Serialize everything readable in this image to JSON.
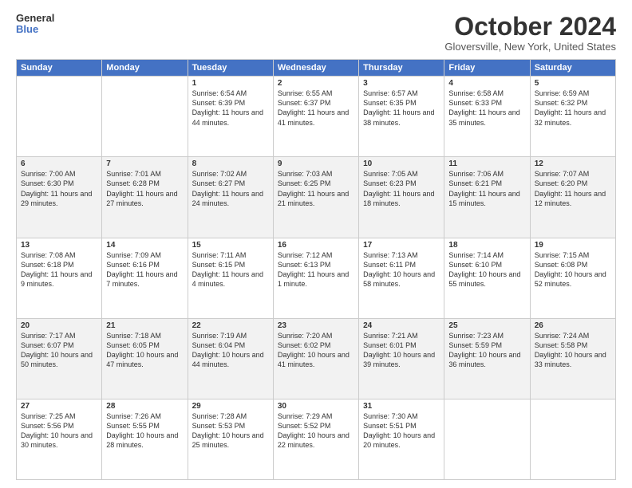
{
  "header": {
    "logo_line1": "General",
    "logo_line2": "Blue",
    "month": "October 2024",
    "location": "Gloversville, New York, United States"
  },
  "weekdays": [
    "Sunday",
    "Monday",
    "Tuesday",
    "Wednesday",
    "Thursday",
    "Friday",
    "Saturday"
  ],
  "weeks": [
    [
      {
        "day": "",
        "sunrise": "",
        "sunset": "",
        "daylight": ""
      },
      {
        "day": "",
        "sunrise": "",
        "sunset": "",
        "daylight": ""
      },
      {
        "day": "1",
        "sunrise": "Sunrise: 6:54 AM",
        "sunset": "Sunset: 6:39 PM",
        "daylight": "Daylight: 11 hours and 44 minutes."
      },
      {
        "day": "2",
        "sunrise": "Sunrise: 6:55 AM",
        "sunset": "Sunset: 6:37 PM",
        "daylight": "Daylight: 11 hours and 41 minutes."
      },
      {
        "day": "3",
        "sunrise": "Sunrise: 6:57 AM",
        "sunset": "Sunset: 6:35 PM",
        "daylight": "Daylight: 11 hours and 38 minutes."
      },
      {
        "day": "4",
        "sunrise": "Sunrise: 6:58 AM",
        "sunset": "Sunset: 6:33 PM",
        "daylight": "Daylight: 11 hours and 35 minutes."
      },
      {
        "day": "5",
        "sunrise": "Sunrise: 6:59 AM",
        "sunset": "Sunset: 6:32 PM",
        "daylight": "Daylight: 11 hours and 32 minutes."
      }
    ],
    [
      {
        "day": "6",
        "sunrise": "Sunrise: 7:00 AM",
        "sunset": "Sunset: 6:30 PM",
        "daylight": "Daylight: 11 hours and 29 minutes."
      },
      {
        "day": "7",
        "sunrise": "Sunrise: 7:01 AM",
        "sunset": "Sunset: 6:28 PM",
        "daylight": "Daylight: 11 hours and 27 minutes."
      },
      {
        "day": "8",
        "sunrise": "Sunrise: 7:02 AM",
        "sunset": "Sunset: 6:27 PM",
        "daylight": "Daylight: 11 hours and 24 minutes."
      },
      {
        "day": "9",
        "sunrise": "Sunrise: 7:03 AM",
        "sunset": "Sunset: 6:25 PM",
        "daylight": "Daylight: 11 hours and 21 minutes."
      },
      {
        "day": "10",
        "sunrise": "Sunrise: 7:05 AM",
        "sunset": "Sunset: 6:23 PM",
        "daylight": "Daylight: 11 hours and 18 minutes."
      },
      {
        "day": "11",
        "sunrise": "Sunrise: 7:06 AM",
        "sunset": "Sunset: 6:21 PM",
        "daylight": "Daylight: 11 hours and 15 minutes."
      },
      {
        "day": "12",
        "sunrise": "Sunrise: 7:07 AM",
        "sunset": "Sunset: 6:20 PM",
        "daylight": "Daylight: 11 hours and 12 minutes."
      }
    ],
    [
      {
        "day": "13",
        "sunrise": "Sunrise: 7:08 AM",
        "sunset": "Sunset: 6:18 PM",
        "daylight": "Daylight: 11 hours and 9 minutes."
      },
      {
        "day": "14",
        "sunrise": "Sunrise: 7:09 AM",
        "sunset": "Sunset: 6:16 PM",
        "daylight": "Daylight: 11 hours and 7 minutes."
      },
      {
        "day": "15",
        "sunrise": "Sunrise: 7:11 AM",
        "sunset": "Sunset: 6:15 PM",
        "daylight": "Daylight: 11 hours and 4 minutes."
      },
      {
        "day": "16",
        "sunrise": "Sunrise: 7:12 AM",
        "sunset": "Sunset: 6:13 PM",
        "daylight": "Daylight: 11 hours and 1 minute."
      },
      {
        "day": "17",
        "sunrise": "Sunrise: 7:13 AM",
        "sunset": "Sunset: 6:11 PM",
        "daylight": "Daylight: 10 hours and 58 minutes."
      },
      {
        "day": "18",
        "sunrise": "Sunrise: 7:14 AM",
        "sunset": "Sunset: 6:10 PM",
        "daylight": "Daylight: 10 hours and 55 minutes."
      },
      {
        "day": "19",
        "sunrise": "Sunrise: 7:15 AM",
        "sunset": "Sunset: 6:08 PM",
        "daylight": "Daylight: 10 hours and 52 minutes."
      }
    ],
    [
      {
        "day": "20",
        "sunrise": "Sunrise: 7:17 AM",
        "sunset": "Sunset: 6:07 PM",
        "daylight": "Daylight: 10 hours and 50 minutes."
      },
      {
        "day": "21",
        "sunrise": "Sunrise: 7:18 AM",
        "sunset": "Sunset: 6:05 PM",
        "daylight": "Daylight: 10 hours and 47 minutes."
      },
      {
        "day": "22",
        "sunrise": "Sunrise: 7:19 AM",
        "sunset": "Sunset: 6:04 PM",
        "daylight": "Daylight: 10 hours and 44 minutes."
      },
      {
        "day": "23",
        "sunrise": "Sunrise: 7:20 AM",
        "sunset": "Sunset: 6:02 PM",
        "daylight": "Daylight: 10 hours and 41 minutes."
      },
      {
        "day": "24",
        "sunrise": "Sunrise: 7:21 AM",
        "sunset": "Sunset: 6:01 PM",
        "daylight": "Daylight: 10 hours and 39 minutes."
      },
      {
        "day": "25",
        "sunrise": "Sunrise: 7:23 AM",
        "sunset": "Sunset: 5:59 PM",
        "daylight": "Daylight: 10 hours and 36 minutes."
      },
      {
        "day": "26",
        "sunrise": "Sunrise: 7:24 AM",
        "sunset": "Sunset: 5:58 PM",
        "daylight": "Daylight: 10 hours and 33 minutes."
      }
    ],
    [
      {
        "day": "27",
        "sunrise": "Sunrise: 7:25 AM",
        "sunset": "Sunset: 5:56 PM",
        "daylight": "Daylight: 10 hours and 30 minutes."
      },
      {
        "day": "28",
        "sunrise": "Sunrise: 7:26 AM",
        "sunset": "Sunset: 5:55 PM",
        "daylight": "Daylight: 10 hours and 28 minutes."
      },
      {
        "day": "29",
        "sunrise": "Sunrise: 7:28 AM",
        "sunset": "Sunset: 5:53 PM",
        "daylight": "Daylight: 10 hours and 25 minutes."
      },
      {
        "day": "30",
        "sunrise": "Sunrise: 7:29 AM",
        "sunset": "Sunset: 5:52 PM",
        "daylight": "Daylight: 10 hours and 22 minutes."
      },
      {
        "day": "31",
        "sunrise": "Sunrise: 7:30 AM",
        "sunset": "Sunset: 5:51 PM",
        "daylight": "Daylight: 10 hours and 20 minutes."
      },
      {
        "day": "",
        "sunrise": "",
        "sunset": "",
        "daylight": ""
      },
      {
        "day": "",
        "sunrise": "",
        "sunset": "",
        "daylight": ""
      }
    ]
  ]
}
